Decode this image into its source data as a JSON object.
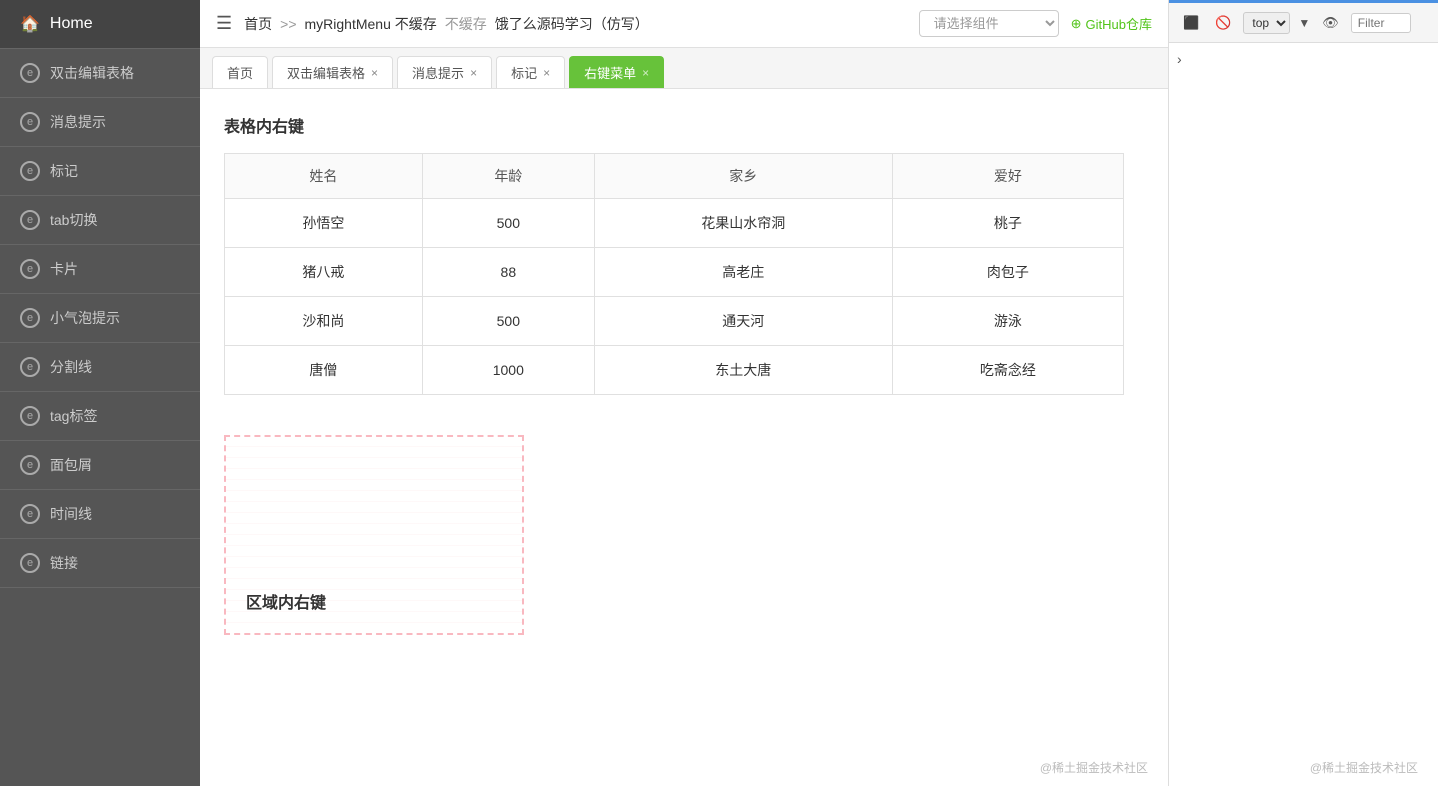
{
  "sidebar": {
    "header": "Home",
    "items": [
      {
        "label": "双击编辑表格",
        "icon": "edit"
      },
      {
        "label": "消息提示",
        "icon": "message"
      },
      {
        "label": "标记",
        "icon": "bookmark"
      },
      {
        "label": "tab切换",
        "icon": "tab"
      },
      {
        "label": "卡片",
        "icon": "card"
      },
      {
        "label": "小气泡提示",
        "icon": "bubble"
      },
      {
        "label": "分割线",
        "icon": "divider"
      },
      {
        "label": "tag标签",
        "icon": "tag"
      },
      {
        "label": "面包屑",
        "icon": "breadcrumb"
      },
      {
        "label": "时间线",
        "icon": "timeline"
      },
      {
        "label": "链接",
        "icon": "link"
      }
    ]
  },
  "topbar": {
    "breadcrumb": {
      "home": "首页",
      "sep1": ">>",
      "menu": "myRightMenu 不缓存",
      "current": "饿了么源码学习（仿写）"
    },
    "component_select_placeholder": "请选择组件",
    "github_label": "GitHub仓库"
  },
  "devtools": {
    "top_label": "top",
    "filter_placeholder": "Filter",
    "arrow": "›"
  },
  "tabs": [
    {
      "label": "首页",
      "closable": false,
      "active": false
    },
    {
      "label": "双击编辑表格",
      "closable": true,
      "active": false
    },
    {
      "label": "消息提示",
      "closable": true,
      "active": false
    },
    {
      "label": "标记",
      "closable": true,
      "active": false
    },
    {
      "label": "右键菜单",
      "closable": true,
      "active": true
    }
  ],
  "content": {
    "table_title": "表格内右键",
    "table": {
      "headers": [
        "姓名",
        "年龄",
        "家乡",
        "爱好"
      ],
      "rows": [
        [
          "孙悟空",
          "500",
          "花果山水帘洞",
          "桃子"
        ],
        [
          "猪八戒",
          "88",
          "高老庄",
          "肉包子"
        ],
        [
          "沙和尚",
          "500",
          "通天河",
          "游泳"
        ],
        [
          "唐僧",
          "1000",
          "东土大唐",
          "吃斋念经"
        ]
      ]
    },
    "dotted_label": "区域内右键",
    "watermark": "@稀土掘金技术社区"
  }
}
